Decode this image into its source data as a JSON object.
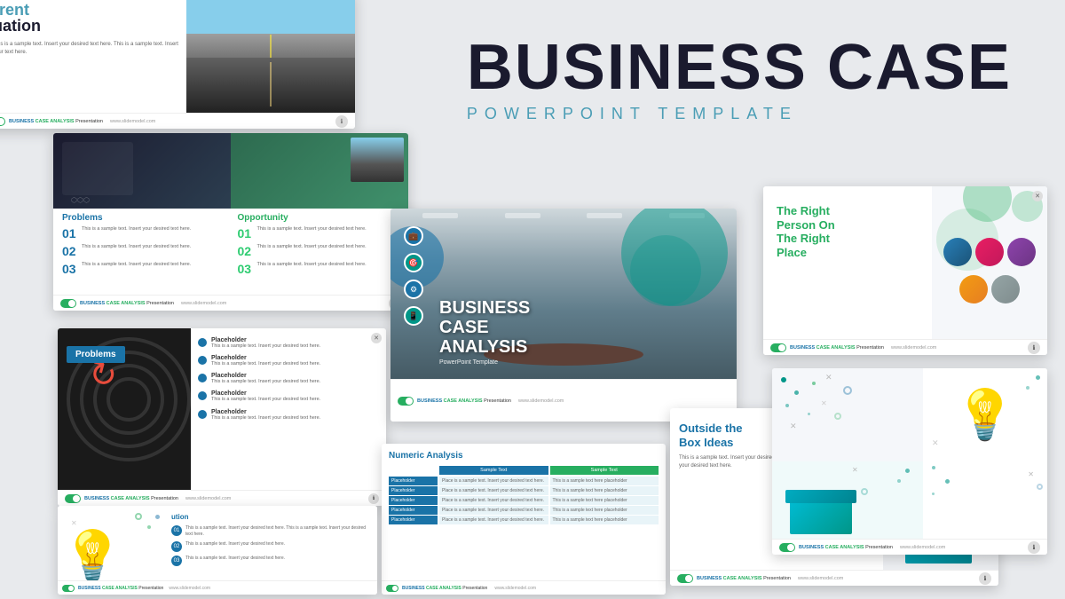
{
  "title": {
    "main": "BUSINESS CASE",
    "sub": "POWERPOINT TEMPLATE"
  },
  "slide1": {
    "title_blue": "rrent",
    "title_black": "uation",
    "text": "This is a sample text. Insert your desired text here. This is a sample text. Insert your text here.",
    "footer_brand": "BUSINESS",
    "footer_brand2": "CASE ANALYSIS",
    "footer_type": "Presentation",
    "footer_url": "www.slidemodel.com"
  },
  "slide2": {
    "problems_label": "Problems",
    "opportunity_label": "Opportunity",
    "items": [
      {
        "num": "01",
        "text": "This is a sample text. Insert your desired text here."
      },
      {
        "num": "02",
        "text": "This is a sample text. Insert your desired text here."
      },
      {
        "num": "03",
        "text": "This is a sample text. Insert your desired text here."
      }
    ],
    "footer_brand": "BUSINESS",
    "footer_brand2": "CASE ANALYSIS",
    "footer_type": "Presentation",
    "footer_url": "www.slidemodel.com"
  },
  "slide3": {
    "problems_label": "Problems",
    "placeholder_label": "Placeholder",
    "items": [
      {
        "text": "This is a sample text. Insert your desired text here."
      },
      {
        "text": "This is a sample text. Insert your desired text here."
      },
      {
        "text": "This is a sample text. Insert your desired text here."
      },
      {
        "text": "This is a sample text. Insert your desired text here."
      },
      {
        "text": "This is a sample text. Insert your desired text here."
      }
    ],
    "footer_brand": "BUSINESS",
    "footer_brand2": "CASE ANALYSIS"
  },
  "slide4": {
    "title_line1": "BUSINESS",
    "title_line2": "CASE",
    "title_line3": "ANALYSIS",
    "subtitle": "PowerPoint Template",
    "footer_brand": "BUSINESS",
    "footer_brand2": "CASE ANALYSIS"
  },
  "slide5": {
    "title": "Numeric Analysis",
    "col1": "Sample Text",
    "col2": "Sample Text",
    "rows": [
      {
        "label": "Placeholder",
        "col1": "Place is a sample text Insert your desired text here.",
        "col2": "This is a sample text here placeholder"
      },
      {
        "label": "Placeholder",
        "col1": "Place is a sample text Insert your desired text here.",
        "col2": "This is a sample text here placeholder"
      },
      {
        "label": "Placeholder",
        "col1": "Place is a sample text Insert your desired text here.",
        "col2": "This is a sample text here placeholder"
      },
      {
        "label": "Placeholder",
        "col1": "Place is a sample text Insert your desired text here.",
        "col2": "This is a sample text here placeholder"
      },
      {
        "label": "Placeholder",
        "col1": "Place is a sample text Insert your desired text here.",
        "col2": "This is a sample text here placeholder"
      }
    ],
    "footer_brand": "BUSINESS",
    "footer_brand2": "CASE ANALYSIS"
  },
  "slide6": {
    "heading_line1": "Outside the",
    "heading_line2": "Box Ideas",
    "text": "This is a sample text. Insert your desired text here. This is a sample text. Insert your desired text here.",
    "footer_brand": "BUSINESS",
    "footer_brand2": "CASE ANALYSIS",
    "footer_type": "Presentation",
    "footer_url": "www.slidemodel.com"
  },
  "slide7": {
    "heading_line1": "The Right",
    "heading_line2": "Person On",
    "heading_line3": "The Right",
    "heading_line4": "Place",
    "footer_brand": "BUSINESS",
    "footer_brand2": "CASE ANALYSIS",
    "footer_type": "Presentation",
    "footer_url": "www.slidemodel.com"
  },
  "slide8": {
    "title": "ution",
    "items": [
      {
        "num": "01",
        "text": "This is a sample text. Insert your desired text here. This is a sample text. Insert your desired text here."
      },
      {
        "num": "02",
        "text": "This is a sample text. Insert your desired text here."
      },
      {
        "num": "03",
        "text": "This is a sample text. Insert your desired text here."
      }
    ],
    "footer_brand": "BUSINESS",
    "footer_brand2": "CASE ANALYSIS"
  },
  "slide9": {
    "footer_brand": "BUSINESS",
    "footer_brand2": "CASE ANALYSIS",
    "footer_type": "Presentation",
    "footer_url": "www.slidemodel.com"
  },
  "colors": {
    "blue": "#1a73a7",
    "green": "#27ae60",
    "teal": "#009688",
    "dark": "#1a1a2e",
    "accent": "#4a9db5"
  }
}
